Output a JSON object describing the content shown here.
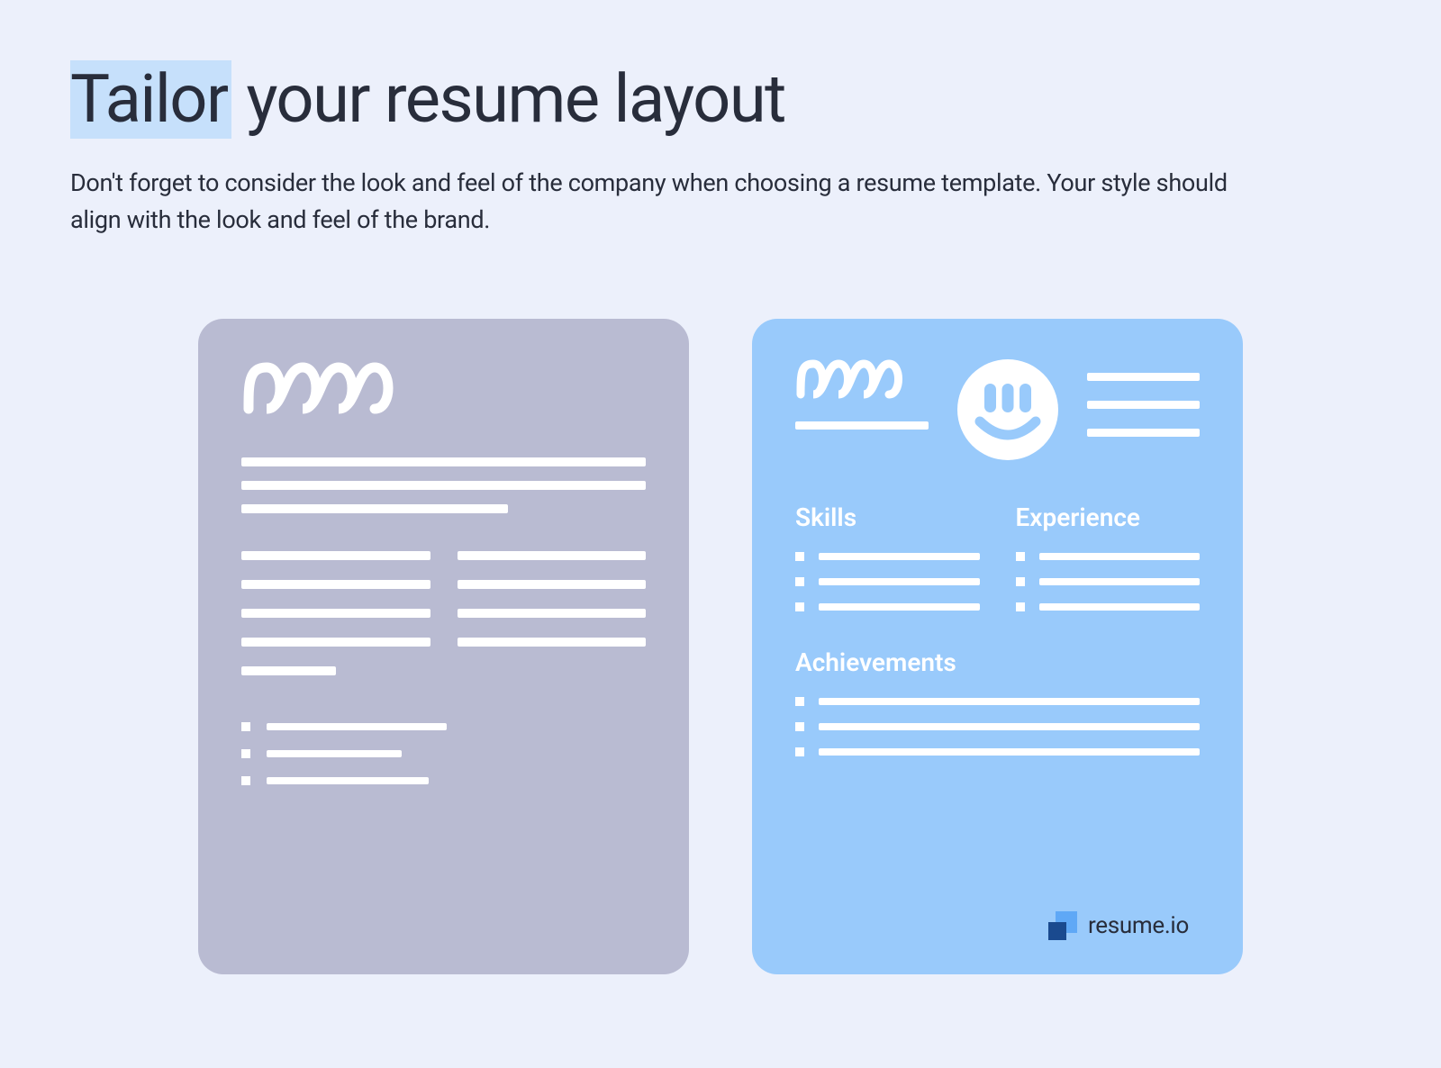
{
  "title": {
    "highlight": "Tailor",
    "rest": " your resume layout"
  },
  "subtitle": "Don't forget to consider the look and feel of the company when choosing a resume template. Your style should align with the look and feel of the brand.",
  "card_blue": {
    "sections": {
      "skills": "Skills",
      "experience": "Experience",
      "achievements": "Achievements"
    }
  },
  "brand": {
    "name": "resume.io"
  },
  "colors": {
    "background": "#ecf0fb",
    "text": "#282d3b",
    "highlight_bg": "#c6e0fb",
    "card_grey": "#b9bbd2",
    "card_blue": "#99cafb",
    "white": "#ffffff",
    "brand_blue_light": "#5fa8f6",
    "brand_blue_dark": "#1a4a8f"
  }
}
